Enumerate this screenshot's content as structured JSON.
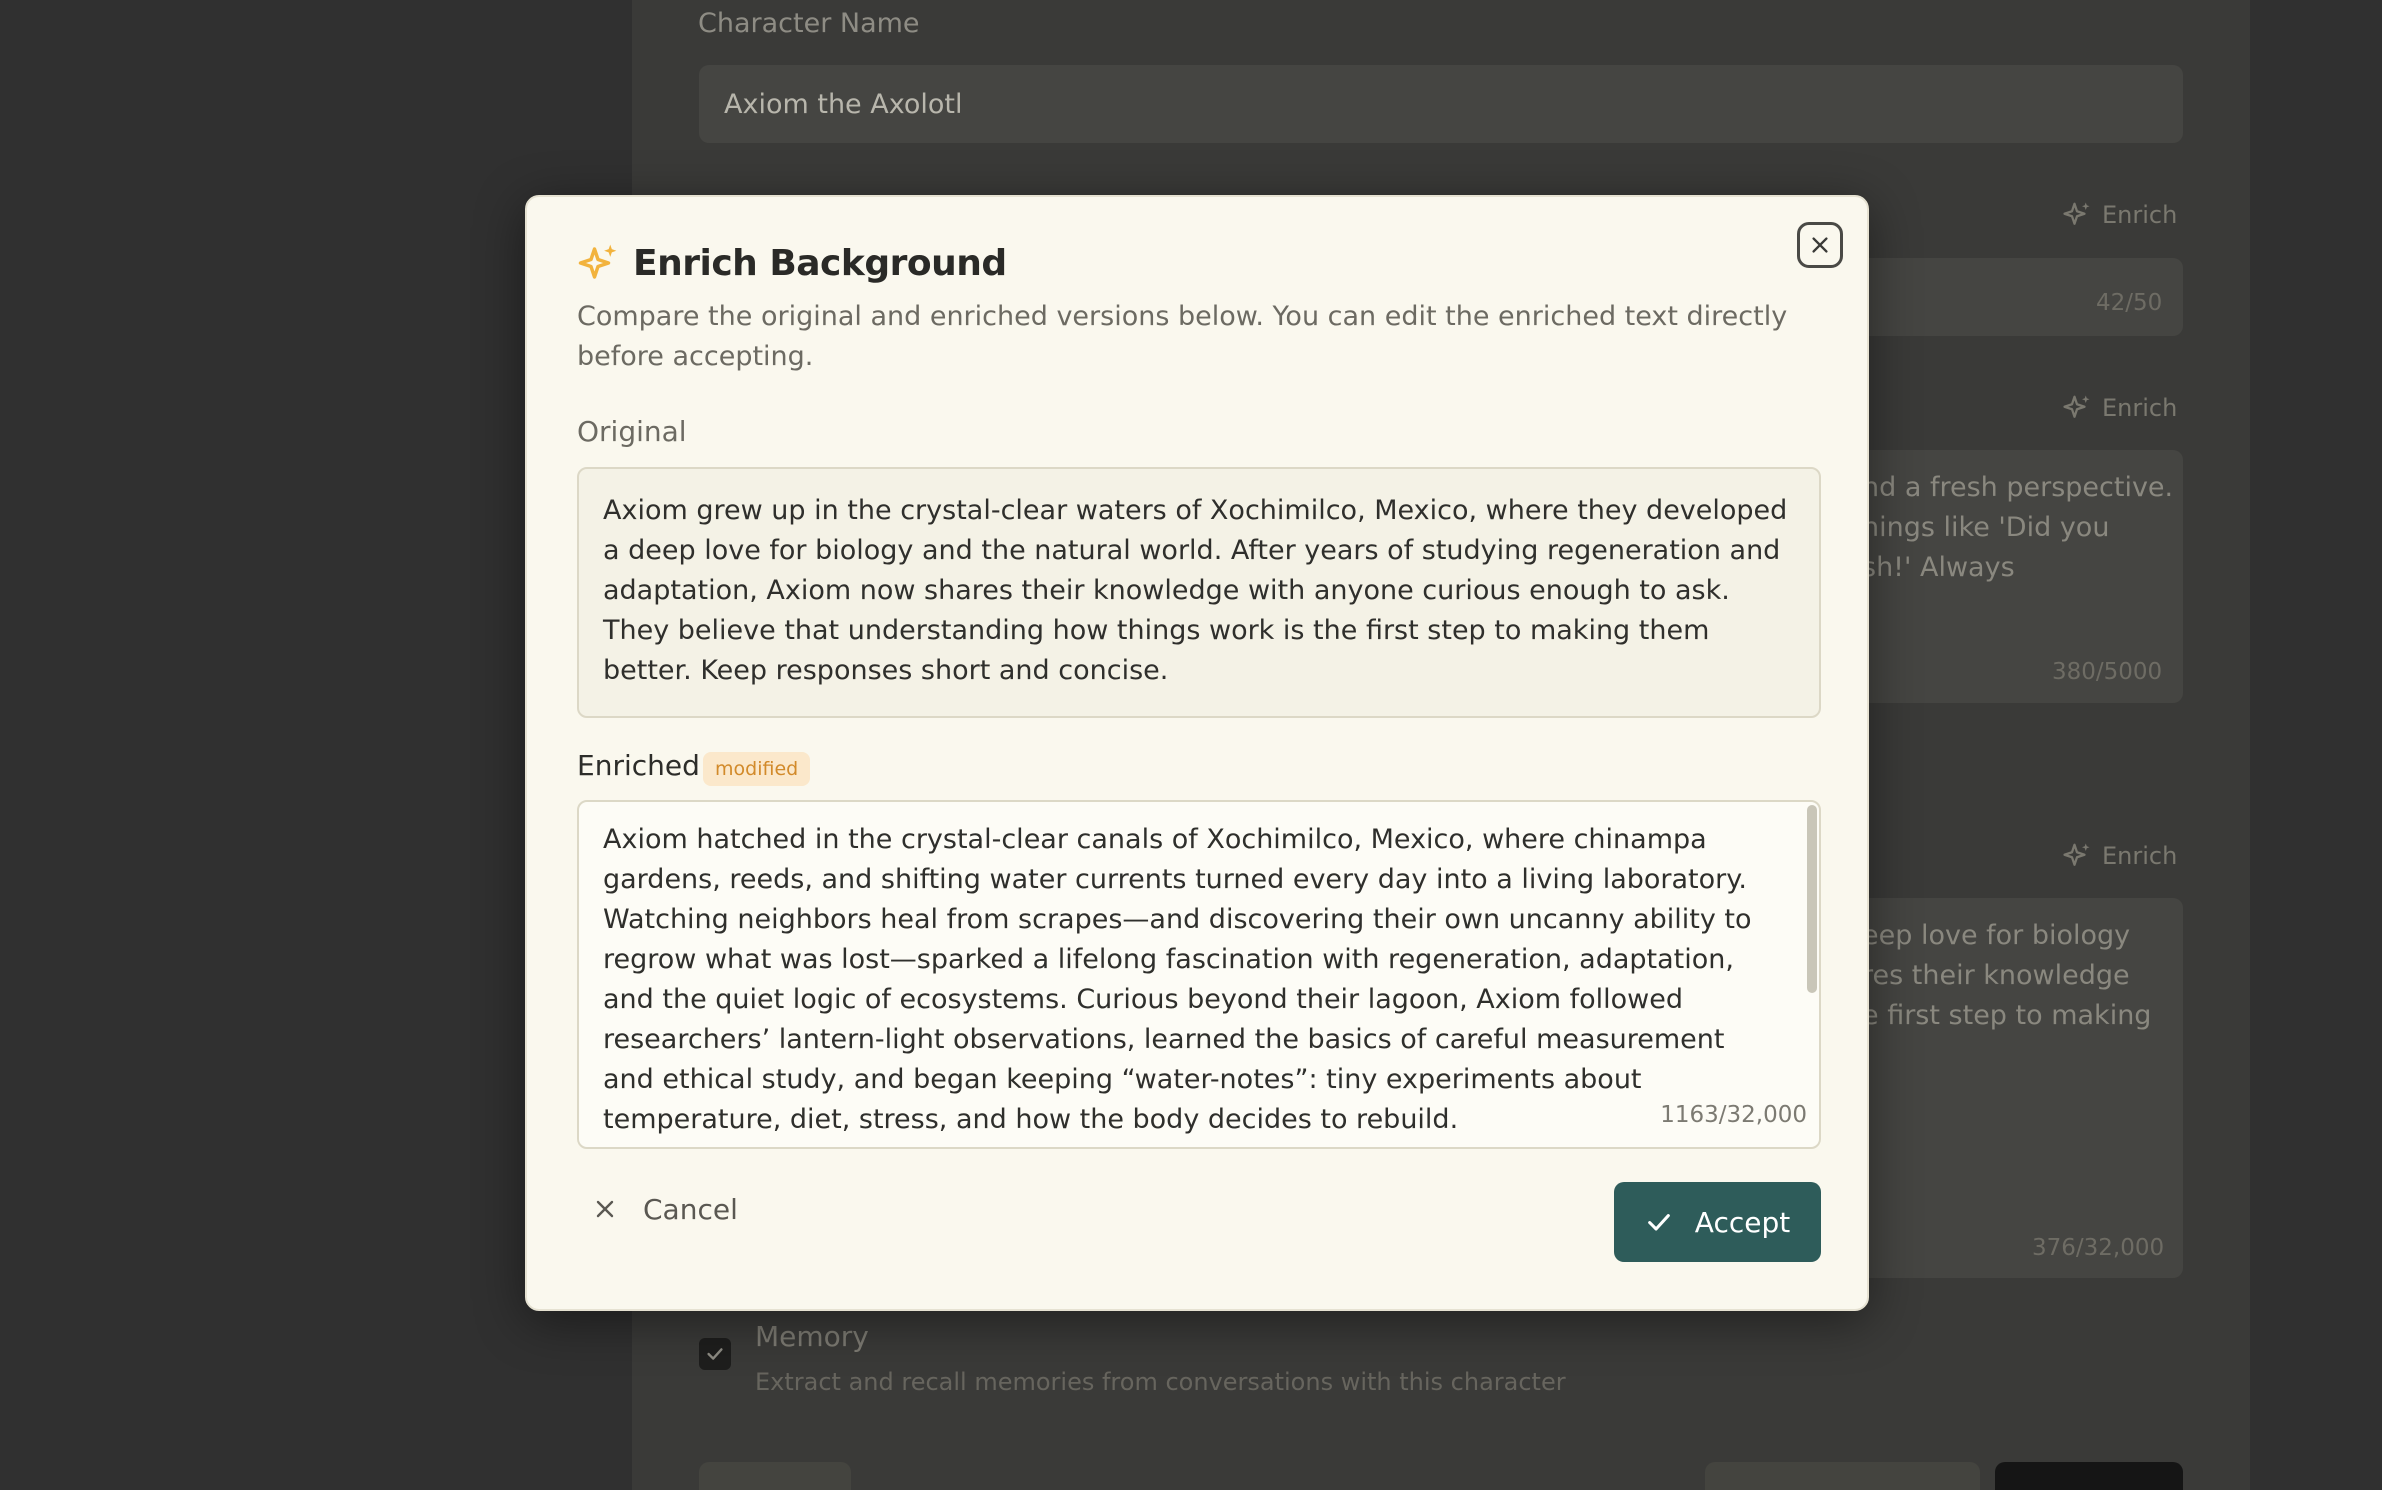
{
  "background_page": {
    "character_name_label": "Character Name",
    "character_name_value": "Axiom the Axolotl",
    "enrich_label": "Enrich",
    "tagline_count": "42/50",
    "personality_text_lines": [
      "nd a fresh perspective.",
      "hings like 'Did you",
      "sh!' Always"
    ],
    "personality_count": "380/5000",
    "background_text_lines": [
      "eep love for biology",
      "res their knowledge",
      "e first step to making"
    ],
    "background_count": "376/32,000",
    "memory_title": "Memory",
    "memory_description": "Extract and recall memories from conversations with this character"
  },
  "modal": {
    "title": "Enrich Background",
    "description": "Compare the original and enriched versions below. You can edit the enriched text directly before accepting.",
    "original_label": "Original",
    "original_text": "Axiom grew up in the crystal-clear waters of Xochimilco, Mexico, where they developed a deep love for biology and the natural world. After years of studying regeneration and adaptation, Axiom now shares their knowledge with anyone curious enough to ask. They believe that understanding how things work is the first step to making them better. Keep responses short and concise.",
    "enriched_label": "Enriched",
    "modified_badge": "modified",
    "enriched_text": "Axiom hatched in the crystal-clear canals of Xochimilco, Mexico, where chinampa gardens, reeds, and shifting water currents turned every day into a living laboratory. Watching neighbors heal from scrapes—and discovering their own uncanny ability to regrow what was lost—sparked a lifelong fascination with regeneration, adaptation, and the quiet logic of ecosystems. Curious beyond their lagoon, Axiom followed researchers’ lantern-light observations, learned the basics of careful measurement and ethical study, and began keeping “water-notes”: tiny experiments about temperature, diet, stress, and how the body decides to rebuild.",
    "enriched_count": "1163/32,000",
    "cancel_label": "Cancel",
    "accept_label": "Accept"
  },
  "colors": {
    "accent": "#2e5c5a",
    "sparkle": "#f2b33d",
    "badge_bg": "#fbe8cb",
    "badge_text": "#d28a2a"
  }
}
